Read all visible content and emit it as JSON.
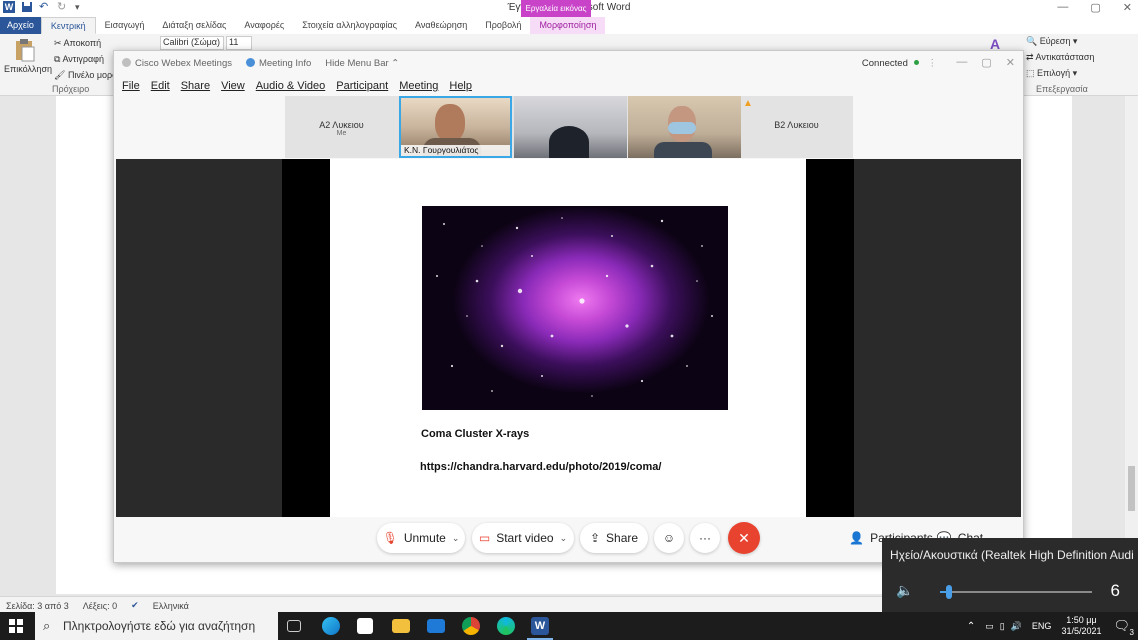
{
  "word": {
    "title": "Έγγραφο1 - Microsoft Word",
    "context_tab": "Εργαλεία εικόνας",
    "tabs": [
      {
        "label": "Αρχείο"
      },
      {
        "label": "Κεντρική"
      },
      {
        "label": "Εισαγωγή"
      },
      {
        "label": "Διάταξη σελίδας"
      },
      {
        "label": "Αναφορές"
      },
      {
        "label": "Στοιχεία αλληλογραφίας"
      },
      {
        "label": "Αναθεώρηση"
      },
      {
        "label": "Προβολή"
      },
      {
        "label": "Μορφοποίηση"
      }
    ],
    "clipboard": {
      "paste": "Επικόλληση",
      "cut": "Αποκοπή",
      "copy": "Αντιγραφή",
      "format_painter": "Πινέλο μορφ",
      "group": "Πρόχειρο"
    },
    "font_name": "Calibri (Σώμα)",
    "font_size": "11",
    "editing": {
      "find": "Εύρεση",
      "replace": "Αντικατάσταση",
      "select": "Επιλογή",
      "group": "Επεξεργασία"
    },
    "status": {
      "page": "Σελίδα: 3 από 3",
      "words": "Λέξεις: 0",
      "language": "Ελληνικά"
    }
  },
  "webex": {
    "app_name": "Cisco Webex Meetings",
    "meeting_info": "Meeting Info",
    "hide_menu": "Hide Menu Bar",
    "connection": "Connected",
    "menu": [
      "File",
      "Edit",
      "Share",
      "View",
      "Audio & Video",
      "Participant",
      "Meeting",
      "Help"
    ],
    "left_label": "Α2 Λυκειου",
    "left_sub": "Me",
    "right_label": "Β2 Λυκειου",
    "active_speaker": "Κ.Ν. Γουργουλιάτος",
    "slide": {
      "caption": "Coma Cluster X-rays",
      "url": "https://chandra.harvard.edu/photo/2019/coma/"
    },
    "controls": {
      "unmute": "Unmute",
      "start_video": "Start video",
      "share": "Share",
      "participants": "Participants",
      "chat": "Chat"
    }
  },
  "volume": {
    "device": "Ηχείο/Ακουστικά (Realtek High Definition Audi...",
    "level": 6
  },
  "taskbar": {
    "search_placeholder": "Πληκτρολογήστε εδώ για αναζήτηση",
    "lang": "ENG",
    "time": "1:50 μμ",
    "date": "31/5/2021",
    "notifications": "3"
  },
  "colors": {
    "word_blue": "#2b579a",
    "context_magenta": "#c843c8",
    "end_red": "#e8432f",
    "active_border": "#3aa8e6",
    "volume_accent": "#4aa0e8"
  }
}
